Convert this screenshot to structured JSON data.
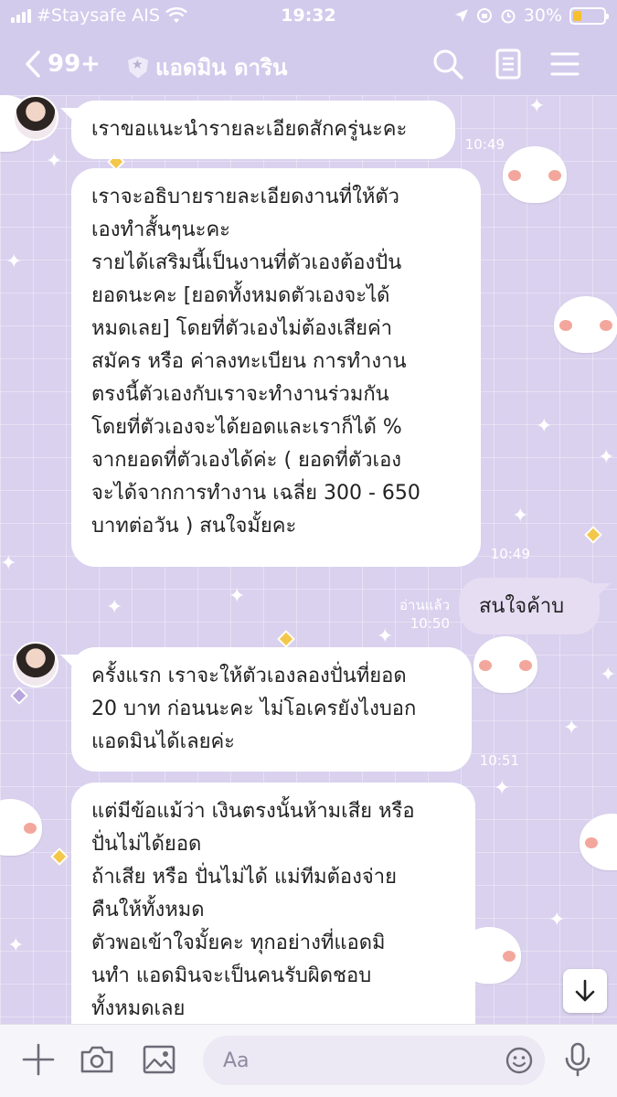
{
  "status": {
    "carrier": "#Staysafe AIS",
    "time": "19:32",
    "battery": "30%"
  },
  "header": {
    "back_count": "99+",
    "title": "แอดมิน ดาริน"
  },
  "messages": [
    {
      "text": "เราขอแนะนำรายละเอียดสักครู่นะคะ",
      "time": "10:49"
    },
    {
      "text": "เราจะอธิบายรายละเอียดงานที่ให้ตัว\nเองทำสั้นๆนะคะ\nรายได้เสริมนี้เป็นงานที่ตัวเองต้องปั่น\nยอดนะคะ [ยอดทั้งหมดตัวเองจะได้\nหมดเลย] โดยที่ตัวเองไม่ต้องเสียค่า\nสมัคร หรือ ค่าลงทะเบียน การทำงาน\nตรงนี้ตัวเองกับเราจะทำงานร่วมกัน\nโดยที่ตัวเองจะได้ยอดและเราก็ได้ %\nจากยอดที่ตัวเองได้ค่ะ ( ยอดที่ตัวเอง\nจะได้จากการทำงาน เฉลี่ย 300 - 650\nบาทต่อวัน ) สนใจมั้ยคะ",
      "time": "10:49"
    },
    {
      "text": "สนใจค้าบ",
      "read": "อ่านแล้ว",
      "time": "10:50"
    },
    {
      "text": "ครั้งแรก เราจะให้ตัวเองลองปั่นที่ยอด\n20 บาท ก่อนนะคะ ไม่โอเครยังไงบอก\nแอดมินได้เลยค่ะ",
      "time": "10:51"
    },
    {
      "text": "แต่มีข้อแม้ว่า เงินตรงนั้นห้ามเสีย หรือ\nปั่นไม่ได้ยอด\nถ้าเสีย หรือ ปั่นไม่ได้ แม่ทีมต้องจ่าย\nคืนให้ทั้งหมด\nตัวพอเข้าใจมั้ยคะ ทุกอย่างที่แอดมิ\nนทำ แอดมินจะเป็นคนรับผิดชอบ\nทั้งหมดเลย"
    }
  ],
  "input": {
    "placeholder": "Aa"
  },
  "colors": {
    "header_bg": "#d3cbec",
    "chat_bg": "#d9d1ee",
    "sent_bubble": "#e6ddf3",
    "received_bubble": "#ffffff"
  }
}
